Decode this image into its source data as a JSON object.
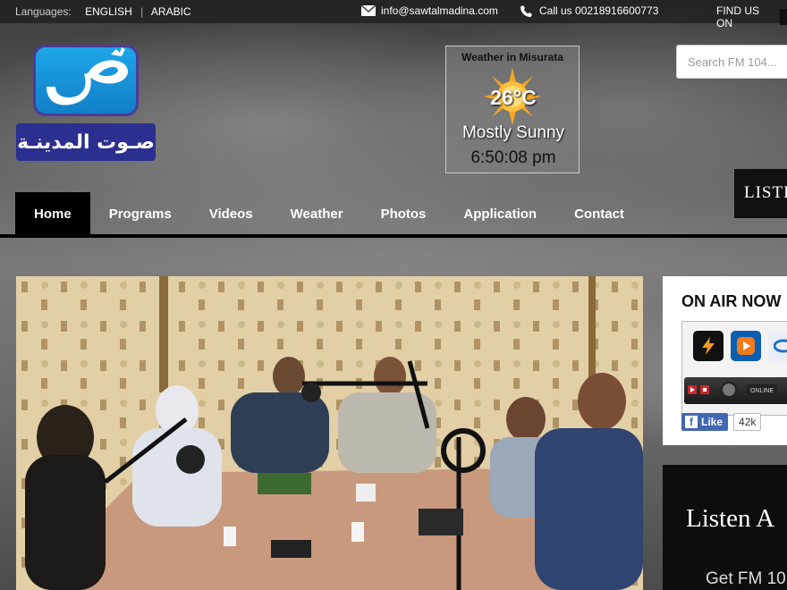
{
  "topbar": {
    "languages_label": "Languages:",
    "lang_english": "ENGLISH",
    "lang_separator": "|",
    "lang_arabic": "ARABIC",
    "email": "info@sawtalmadina.com",
    "phone": "Call us 00218916600773",
    "find_us": "FIND US ON"
  },
  "logo": {
    "wordmark": "صـوت المدينـة"
  },
  "weather": {
    "title": "Weather in Misurata",
    "temperature": "26°C",
    "condition": "Mostly Sunny",
    "time": "6:50:08 pm"
  },
  "search": {
    "placeholder": "Search FM 104..."
  },
  "listen_tab": {
    "label": "LISTE"
  },
  "nav": {
    "items": [
      {
        "label": "Home"
      },
      {
        "label": "Programs"
      },
      {
        "label": "Videos"
      },
      {
        "label": "Weather"
      },
      {
        "label": "Photos"
      },
      {
        "label": "Application"
      },
      {
        "label": "Contact"
      }
    ]
  },
  "on_air": {
    "title": "ON AIR NOW",
    "player_label": "ONLINE",
    "like_label": "Like",
    "like_count": "42k"
  },
  "listen_panel": {
    "headline": "Listen A",
    "subline": "Get FM 10"
  },
  "colors": {
    "nav_active": "#000000",
    "facebook": "#4267b2",
    "logo_blue": "#1ea6e8",
    "logo_purple": "#2b2f8f"
  }
}
